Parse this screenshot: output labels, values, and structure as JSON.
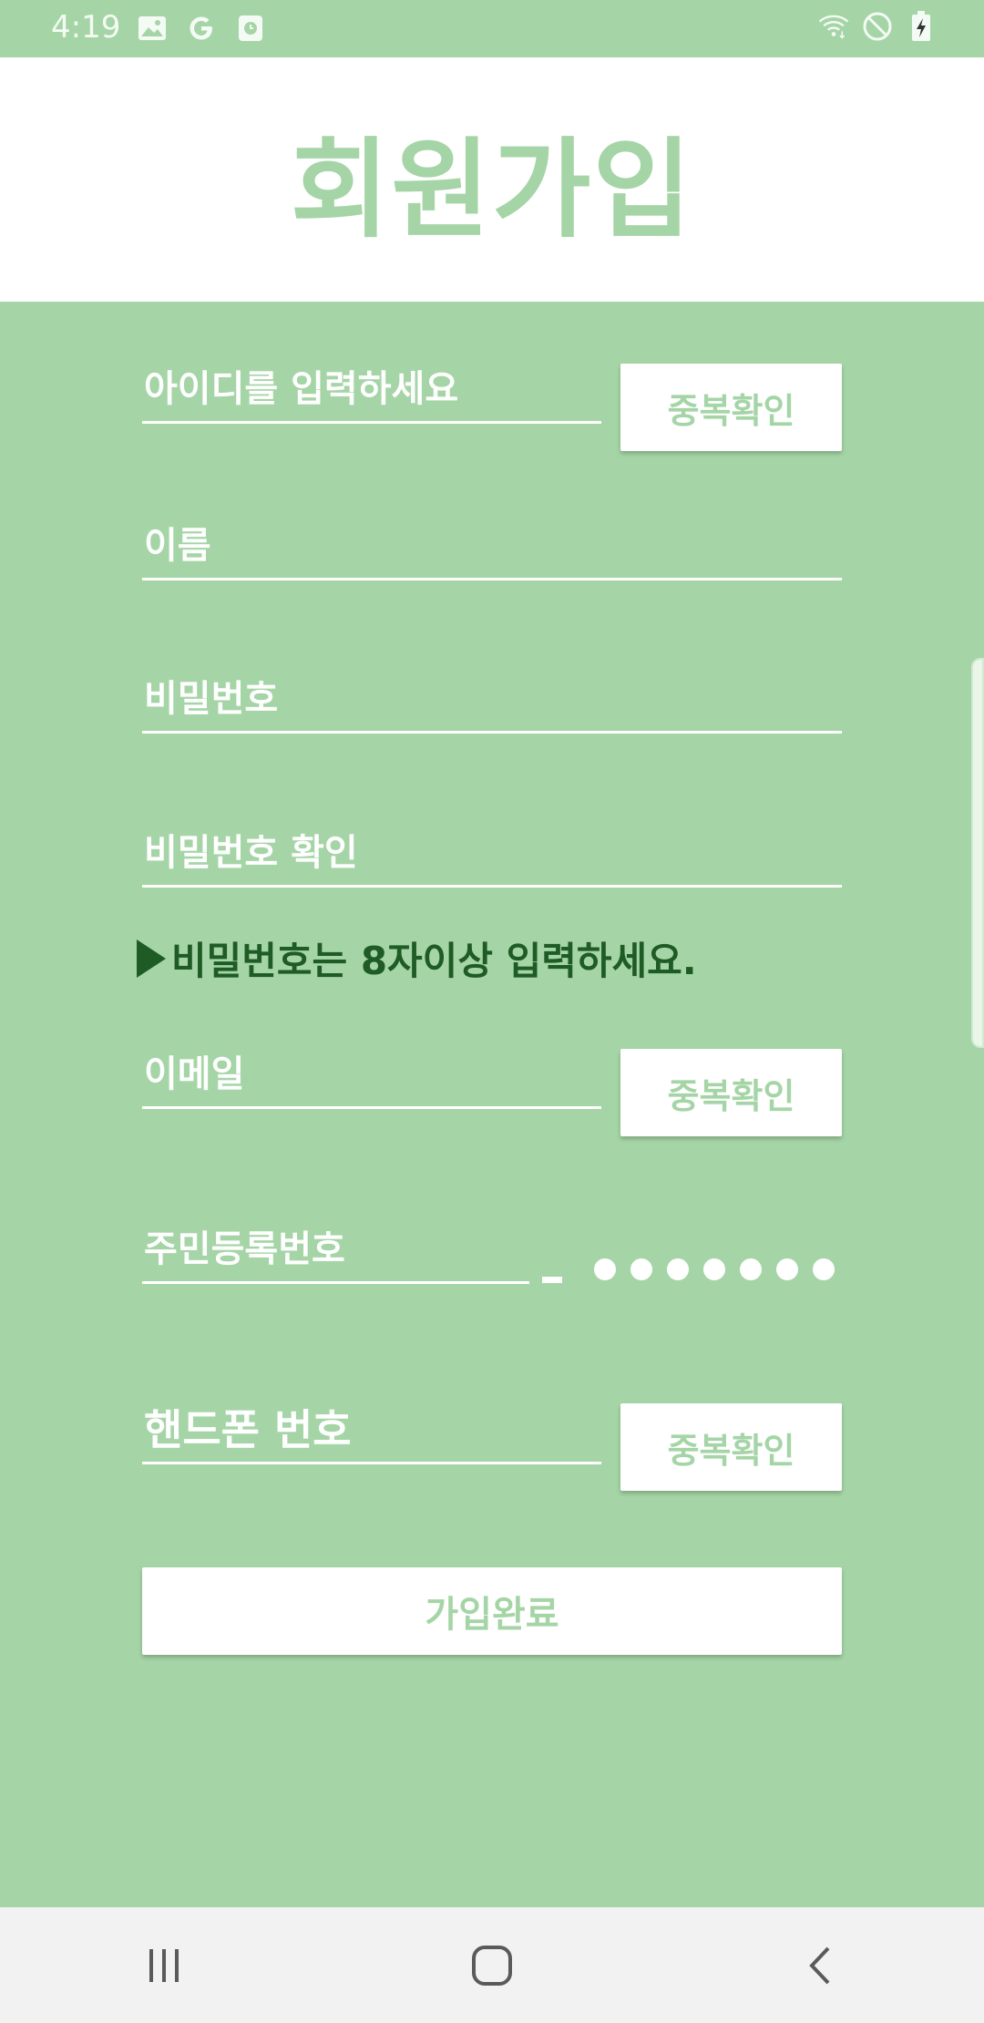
{
  "status_bar": {
    "time": "4:19",
    "left_icons": [
      "image-icon",
      "google-icon",
      "clock-app-icon"
    ],
    "right_icons": [
      "wifi-icon",
      "do-not-disturb-icon",
      "battery-charging-icon"
    ]
  },
  "header": {
    "title": "회원가입"
  },
  "form": {
    "id_field": {
      "placeholder": "아이디를 입력하세요",
      "value": ""
    },
    "id_check_button": "중복확인",
    "name_field": {
      "placeholder": "이름",
      "value": ""
    },
    "password_field": {
      "placeholder": "비밀번호",
      "value": ""
    },
    "password_confirm_field": {
      "placeholder": "비밀번호 확인",
      "value": ""
    },
    "password_hint": "비밀번호는 8자이상 입력하세요.",
    "email_field": {
      "placeholder": "이메일",
      "value": ""
    },
    "email_check_button": "중복확인",
    "rrn_field": {
      "placeholder": "주민등록번호",
      "value": ""
    },
    "rrn_masked_digits": 7,
    "phone_field": {
      "placeholder": "핸드폰 번호",
      "value": ""
    },
    "phone_check_button": "중복확인",
    "submit_button": "가입완료"
  },
  "nav_bar": {
    "buttons": [
      "recent-apps-icon",
      "home-icon",
      "back-icon"
    ]
  },
  "colors": {
    "accent": "#a5d5a6",
    "hint": "#1f5b24",
    "white": "#ffffff",
    "nav_bg": "#f2f2f2"
  }
}
